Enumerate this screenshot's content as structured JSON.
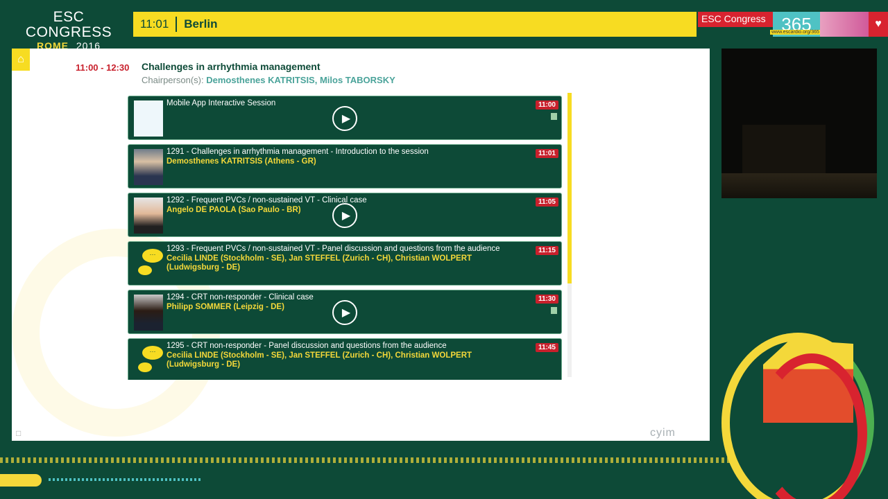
{
  "brand": {
    "title": "ESC CONGRESS",
    "city": "ROME",
    "year": "2016"
  },
  "timebar": {
    "time": "11:01",
    "city": "Berlin"
  },
  "logo": {
    "label": "ESC Congress",
    "number": "365",
    "url": "www.escardio.org/365"
  },
  "session": {
    "time": "11:00 - 12:30",
    "title": "Challenges in arrhythmia management",
    "chair_label": "Chairperson(s):",
    "chairs": "Demosthenes KATRITSIS, Milos TABORSKY"
  },
  "talks": [
    {
      "title": "Mobile App Interactive Session",
      "speakers": "",
      "time": "11:00"
    },
    {
      "title": "1291 - Challenges in arrhythmia management - Introduction to the session",
      "speakers": "Demosthenes KATRITSIS (Athens - GR)",
      "time": "11:01"
    },
    {
      "title": "1292 - Frequent PVCs / non-sustained VT - Clinical case",
      "speakers": "Angelo DE PAOLA (Sao Paulo - BR)",
      "time": "11:05"
    },
    {
      "title": "1293 - Frequent PVCs / non-sustained VT - Panel discussion and questions from the audience",
      "speakers": "Cecilia LINDE (Stockholm - SE), Jan STEFFEL (Zurich - CH), Christian WOLPERT (Ludwigsburg - DE)",
      "time": "11:15"
    },
    {
      "title": "1294 - CRT non-responder - Clinical case",
      "speakers": "Philipp SOMMER (Leipzig - DE)",
      "time": "11:30"
    },
    {
      "title": "1295 - CRT non-responder - Panel discussion and questions from the audience",
      "speakers": "Cecilia LINDE (Stockholm - SE), Jan STEFFEL (Zurich - CH), Christian WOLPERT (Ludwigsburg - DE)",
      "time": "11:45"
    }
  ],
  "footer": {
    "vendor": "cyim"
  },
  "colors": {
    "green": "#0d4a37",
    "yellow": "#f7dc22",
    "red": "#c8202c"
  }
}
